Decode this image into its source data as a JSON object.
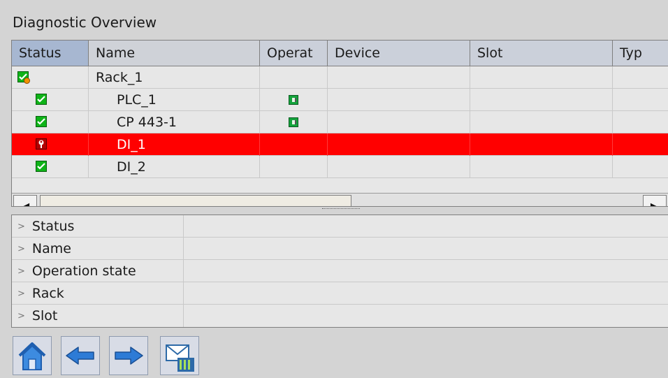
{
  "title": "Diagnostic Overview",
  "columns": [
    "Status",
    "Name",
    "Operat",
    "Device",
    "Slot",
    "Typ"
  ],
  "rows": [
    {
      "status_icon": "rack-warning-icon",
      "name": "Rack_1",
      "op_icon": "",
      "selected": false
    },
    {
      "status_icon": "ok-check-icon",
      "name": "PLC_1",
      "op_icon": "run-state-icon",
      "selected": false
    },
    {
      "status_icon": "ok-check-icon",
      "name": "CP 443-1",
      "op_icon": "run-state-icon",
      "selected": false
    },
    {
      "status_icon": "maintenance-wrench-icon",
      "name": "DI_1",
      "op_icon": "",
      "selected": true
    },
    {
      "status_icon": "ok-check-icon",
      "name": "DI_2",
      "op_icon": "",
      "selected": false
    }
  ],
  "details": {
    "labels": [
      "Status",
      "Name",
      "Operation state",
      "Rack",
      "Slot"
    ]
  },
  "toolbar": {
    "buttons": [
      "home-icon",
      "back-arrow-icon",
      "forward-arrow-icon",
      "message-mail-icon"
    ]
  },
  "colors": {
    "selection": "#ff0000",
    "ok": "#0fb318",
    "nav_blue": "#2d7bd6"
  }
}
